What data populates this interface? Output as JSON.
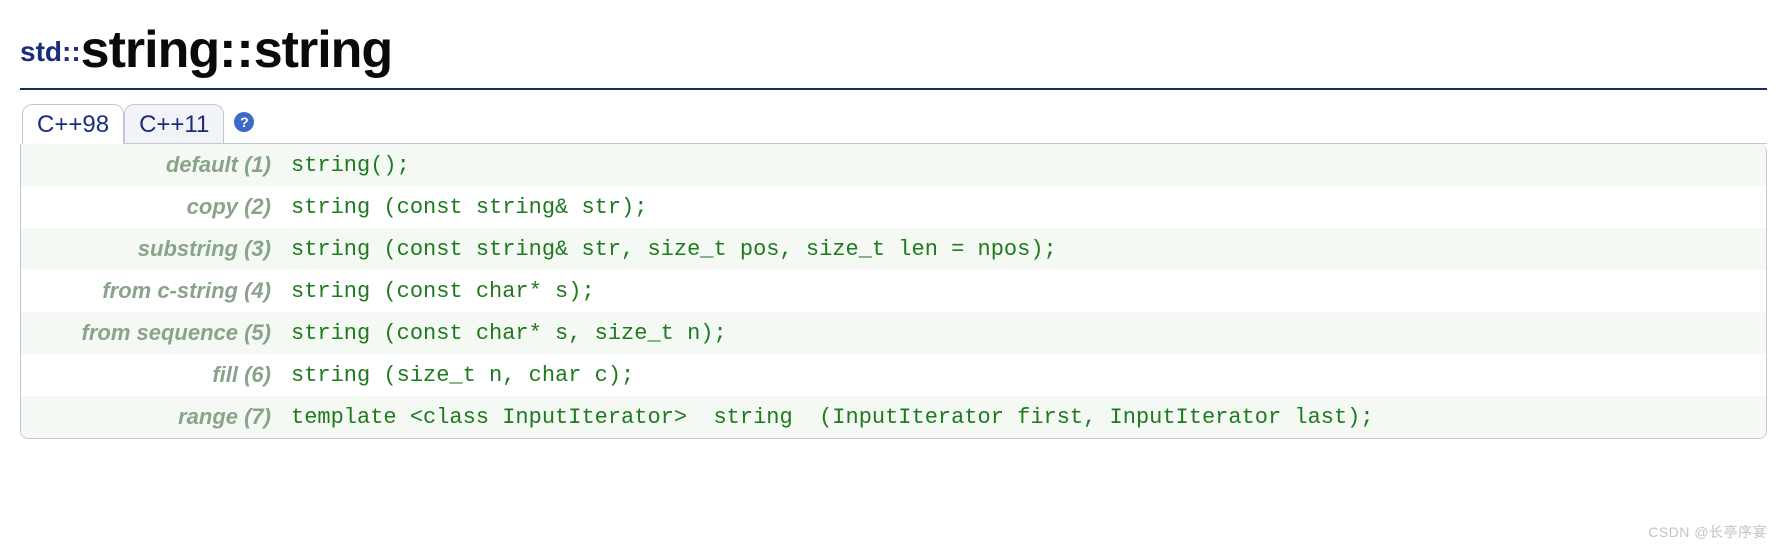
{
  "title": {
    "namespace": "std::",
    "class": "string",
    "separator": "::",
    "member": "string"
  },
  "tabs": [
    {
      "label": "C++98",
      "active": true
    },
    {
      "label": "C++11",
      "active": false
    }
  ],
  "help": "?",
  "prototypes": [
    {
      "label": "default (1)",
      "signature": "string();"
    },
    {
      "label": "copy (2)",
      "signature": "string (const string& str);"
    },
    {
      "label": "substring (3)",
      "signature": "string (const string& str, size_t pos, size_t len = npos);"
    },
    {
      "label": "from c-string (4)",
      "signature": "string (const char* s);"
    },
    {
      "label": "from sequence (5)",
      "signature": "string (const char* s, size_t n);"
    },
    {
      "label": "fill (6)",
      "signature": "string (size_t n, char c);"
    },
    {
      "label": "range (7)",
      "signature": "template <class InputIterator>  string  (InputIterator first, InputIterator last);"
    }
  ],
  "watermark": "CSDN @长亭序宴"
}
